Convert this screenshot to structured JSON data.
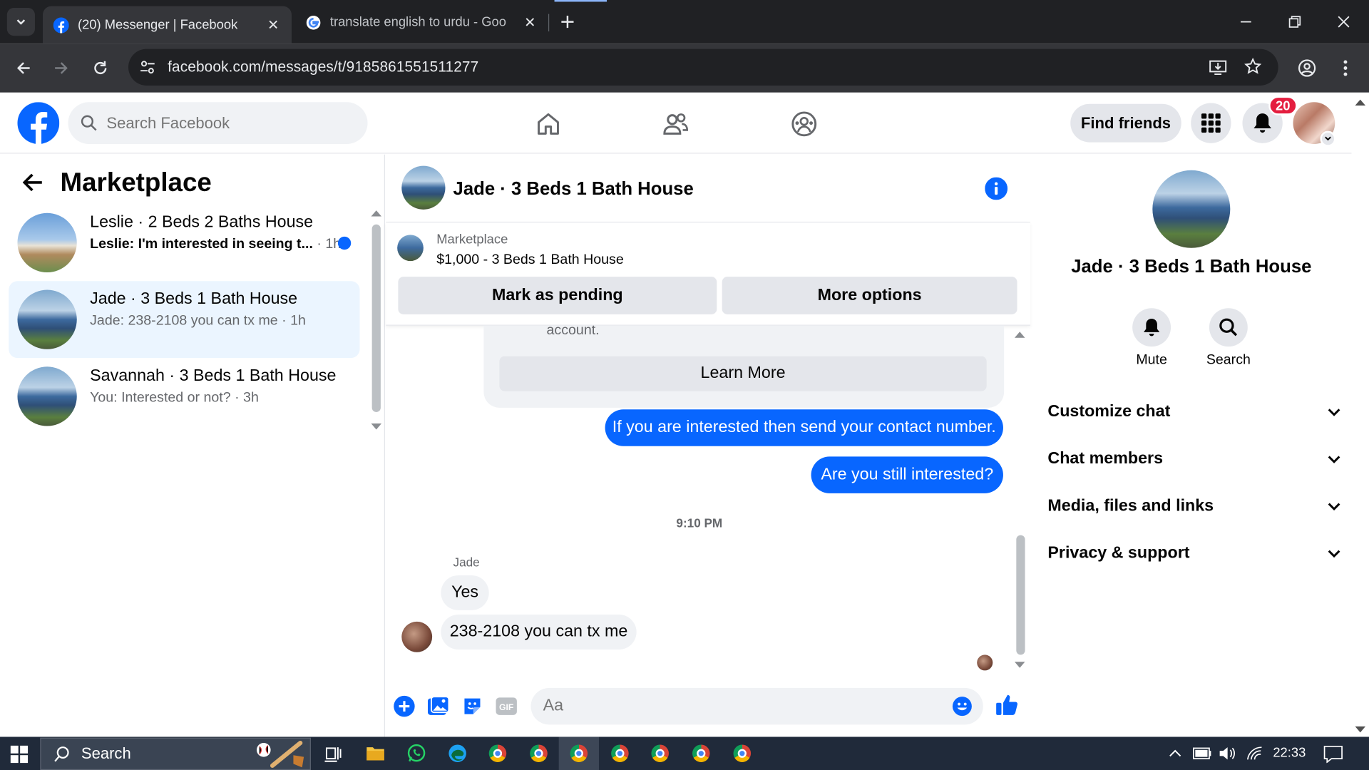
{
  "browser": {
    "tabs": [
      {
        "title": "(20) Messenger | Facebook",
        "active": true
      },
      {
        "title": "translate english to urdu - Goo",
        "active": false
      }
    ],
    "url": "facebook.com/messages/t/9185861551511277"
  },
  "header": {
    "search_placeholder": "Search Facebook",
    "find_friends_label": "Find friends",
    "notification_count": "20"
  },
  "left": {
    "title": "Marketplace",
    "conversations": [
      {
        "name": "Leslie · 2 Beds 2 Baths House",
        "preview": "Leslie: I'm interested in seeing t...",
        "time": " · 1h",
        "unread": true
      },
      {
        "name": "Jade · 3 Beds 1 Bath House",
        "preview": "Jade: 238-2108 you can tx me · 1h",
        "selected": true
      },
      {
        "name": "Savannah · 3 Beds 1 Bath House",
        "preview": "You: Interested or not? · 3h"
      }
    ]
  },
  "chat": {
    "title": "Jade · 3 Beds 1 Bath House",
    "marketplace_label": "Marketplace",
    "listing": "$1,000 - 3 Beds 1 Bath House",
    "mark_pending_label": "Mark as pending",
    "more_options_label": "More options",
    "system_text_tail": "account.",
    "learn_more_label": "Learn More",
    "messages_me": [
      "If you are interested then send your contact number.",
      "Are you still interested?"
    ],
    "timestamp": "9:10 PM",
    "sender_name": "Jade",
    "messages_them": [
      "Yes",
      "238-2108 you can tx me"
    ],
    "input_placeholder": "Aa"
  },
  "right": {
    "name": "Jade · 3 Beds 1 Bath House",
    "mute_label": "Mute",
    "search_label": "Search",
    "sections": [
      "Customize chat",
      "Chat members",
      "Media, files and links",
      "Privacy & support"
    ]
  },
  "taskbar": {
    "search_label": "Search",
    "clock": "22:33"
  },
  "colors": {
    "accent": "#0866ff",
    "fb_blue": "#0866ff",
    "badge": "#e41e3f"
  }
}
